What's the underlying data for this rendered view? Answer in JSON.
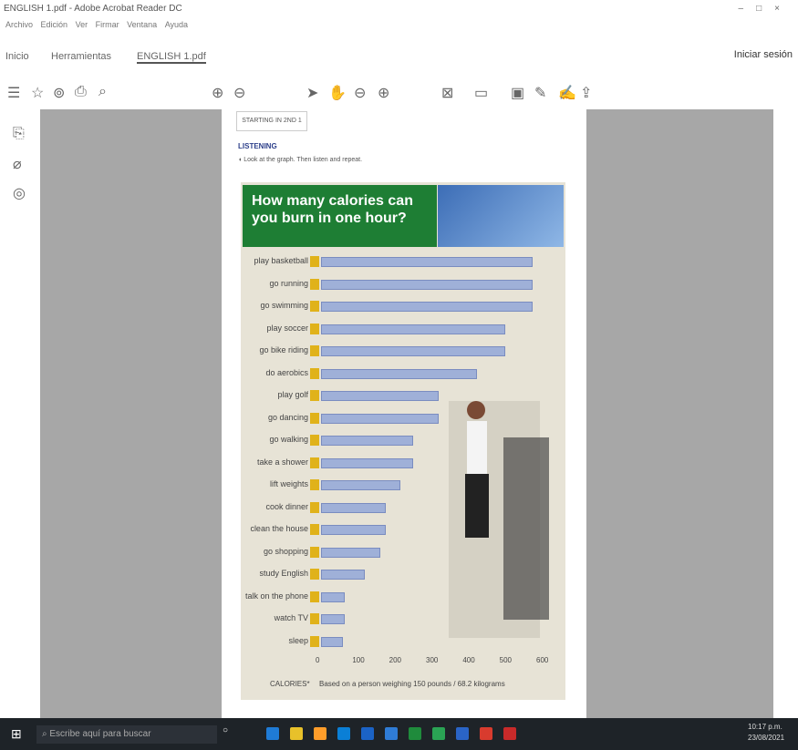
{
  "window": {
    "title": "ENGLISH 1.pdf - Adobe Acrobat Reader DC"
  },
  "menu": [
    "Archivo",
    "Edición",
    "Ver",
    "Firmar",
    "Ventana",
    "Ayuda"
  ],
  "tabs": {
    "home": "Inicio",
    "tools": "Herramientas",
    "file": "ENGLISH 1.pdf"
  },
  "header_right": {
    "signin": "Iniciar sesión"
  },
  "document": {
    "section": "LISTENING",
    "instruction": "Look at the graph. Then listen and repeat.",
    "unit_label": "STARTING IN 2ND 1"
  },
  "taskbar": {
    "search_placeholder": "Escribe aquí para buscar",
    "time": "10:17 p.m.",
    "date": "23/08/2021"
  },
  "chart_data": {
    "type": "bar",
    "title": "How many calories can you burn in one hour?",
    "categories": [
      "play basketball",
      "go running",
      "go swimming",
      "play soccer",
      "go bike riding",
      "do aerobics",
      "play golf",
      "go dancing",
      "go walking",
      "take a shower",
      "lift weights",
      "cook dinner",
      "clean the house",
      "go shopping",
      "study English",
      "talk on the phone",
      "watch TV",
      "sleep"
    ],
    "values": [
      576,
      576,
      576,
      500,
      500,
      425,
      320,
      320,
      250,
      250,
      215,
      175,
      175,
      160,
      120,
      65,
      65,
      60
    ],
    "xlim": [
      0,
      600
    ],
    "xticks": [
      "0",
      "100",
      "200",
      "300",
      "400",
      "500",
      "600"
    ],
    "xlabel": "CALORIES*",
    "footnote": "Based on a person weighing 150 pounds / 68.2 kilograms"
  }
}
